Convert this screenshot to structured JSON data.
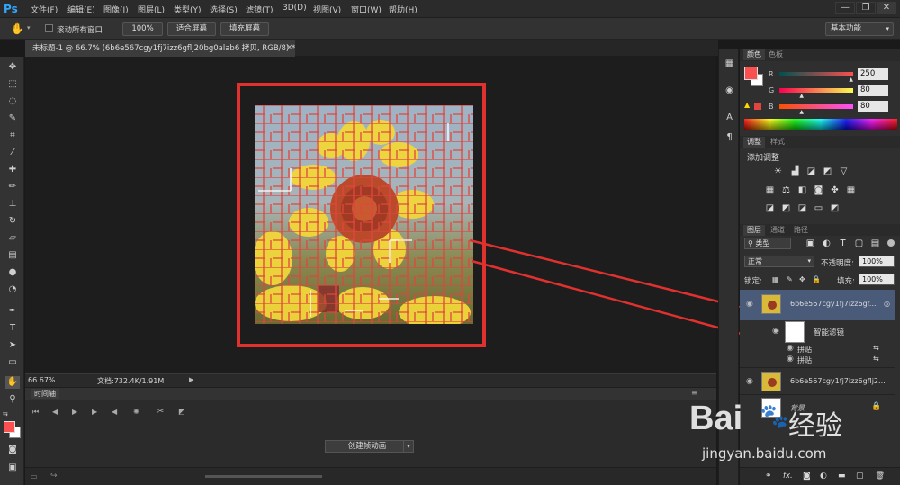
{
  "app": {
    "logo": "Ps"
  },
  "menu": [
    "文件(F)",
    "编辑(E)",
    "图像(I)",
    "图层(L)",
    "类型(Y)",
    "选择(S)",
    "滤镜(T)",
    "3D(D)",
    "视图(V)",
    "窗口(W)",
    "帮助(H)"
  ],
  "window_controls": {
    "minimize": "—",
    "restore": "❐",
    "close": "✕"
  },
  "options": {
    "scroll_all_label": "滚动所有窗口",
    "zoom_100": "100%",
    "fit_screen": "适合屏幕",
    "fill_screen": "填充屏幕",
    "workspace": "基本功能"
  },
  "document": {
    "tab_title": "未标题-1 @ 66.7% (6b6e567cgy1fj7izz6gflj20bg0alab6 拷贝, RGB/8) *",
    "tab_close": "×"
  },
  "status": {
    "zoom": "66.67%",
    "doc_info": "文档:732.4K/1.91M"
  },
  "timeline": {
    "title": "时间轴",
    "create_button": "创建帧动画"
  },
  "color_panel": {
    "tab_color": "颜色",
    "tab_swatches": "色板",
    "r_label": "R",
    "g_label": "G",
    "b_label": "B",
    "r_value": "250",
    "g_value": "80",
    "b_value": "80",
    "r_level": 0.98,
    "g_level": 0.31,
    "b_level": 0.31,
    "foreground_color": "#fa5050",
    "background_color": "#ffffff"
  },
  "adjust_panel": {
    "tab_adjust": "调整",
    "tab_styles": "样式",
    "title": "添加调整"
  },
  "layers_panel": {
    "tab_layers": "图层",
    "tab_channels": "通道",
    "tab_paths": "路径",
    "filter_kind": "类型",
    "blend_mode": "正常",
    "opacity_label": "不透明度:",
    "opacity_value": "100%",
    "lock_label": "锁定:",
    "fill_label": "填充:",
    "fill_value": "100%",
    "layers": [
      {
        "name": "6b6e567cgy1fj7izz6gflj20bg0alab6 拷贝",
        "display": "6b6e567cgy1fj7izz6gf..."
      },
      {
        "name": "智能滤镜"
      },
      {
        "name": "拼贴"
      },
      {
        "name": "拼贴"
      },
      {
        "name": "6b6e567cgy1fj7izz6gflj2...",
        "display": "6b6e567cgy1fj7izz6gflj2..."
      },
      {
        "name": "背景"
      }
    ],
    "footer_fx": "fx."
  },
  "watermark": {
    "brand_text": "Bai",
    "brand_tail": "经验",
    "url": "jingyan.baidu.com"
  },
  "colors": {
    "accent_red": "#e0312f",
    "panel_bg": "#2f2f2f",
    "selected_row": "#4a5b7a"
  }
}
